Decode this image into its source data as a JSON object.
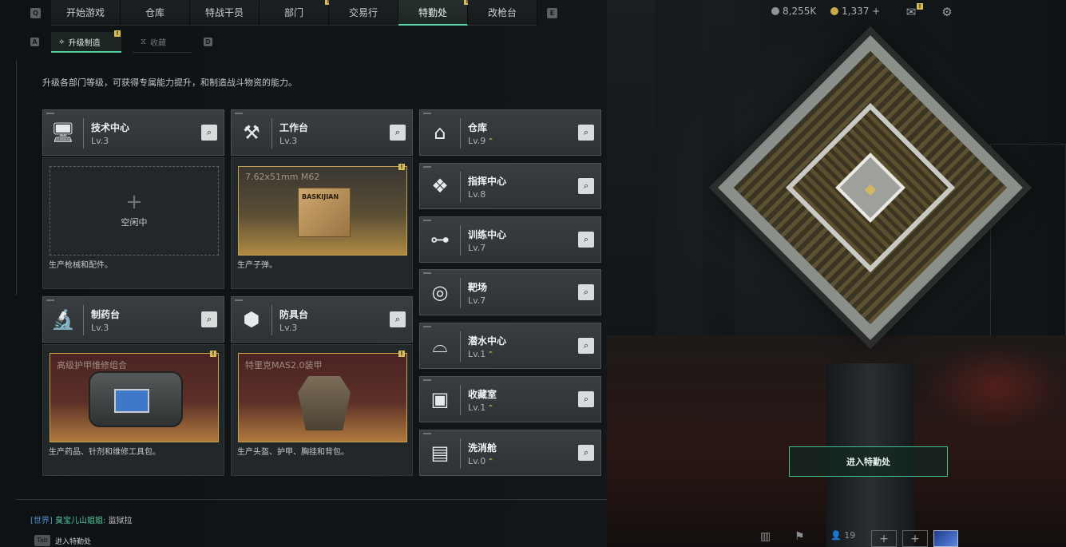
{
  "nav": {
    "left_key": "Q",
    "right_key": "E",
    "tabs": [
      {
        "label": "开始游戏",
        "badge": ""
      },
      {
        "label": "仓库",
        "badge": ""
      },
      {
        "label": "特战干员",
        "badge": ""
      },
      {
        "label": "部门",
        "badge": "!"
      },
      {
        "label": "交易行",
        "badge": ""
      },
      {
        "label": "特勤处",
        "badge": "!",
        "active": true
      },
      {
        "label": "改枪台",
        "badge": ""
      }
    ],
    "currency_silver": "8,255K",
    "currency_gold": "1,337 +",
    "mail_badge": "!",
    "icons": [
      "silver-coin-icon",
      "gold-coin-icon",
      "mail-icon",
      "gear-icon"
    ]
  },
  "subnav": {
    "left_key": "A",
    "right_key": "D",
    "active_label": "升级制造",
    "active_badge": "!",
    "inactive_label": "收藏"
  },
  "description": "升级各部门等级，可获得专属能力提升，和制造战斗物资的能力。",
  "workshops": [
    {
      "name": "技术中心",
      "level": "Lv.3",
      "icon": "monitor-icon",
      "slot": {
        "type": "idle",
        "idle_label": "空闲中",
        "plus": "+"
      },
      "caption": "生产枪械和配件。"
    },
    {
      "name": "工作台",
      "level": "Lv.3",
      "icon": "tools-icon",
      "slot": {
        "type": "item",
        "item_name": "7.62x51mm M62",
        "badge": "!",
        "box_label": "BASKIJIAN"
      },
      "caption": "生产子弹。"
    },
    {
      "name": "制药台",
      "level": "Lv.3",
      "icon": "microscope-icon",
      "slot": {
        "type": "item",
        "item_name": "高级护甲维修组合",
        "badge": "!"
      },
      "caption": "生产药品、针剂和维修工具包。"
    },
    {
      "name": "防具台",
      "level": "Lv.3",
      "icon": "cubes-icon",
      "slot": {
        "type": "item",
        "item_name": "特里克MAS2.0装甲",
        "badge": "!"
      },
      "caption": "生产头盔、护甲、胸挂和背包。"
    }
  ],
  "facilities": [
    {
      "name": "仓库",
      "level": "Lv.9",
      "upgrade": "⌃",
      "icon": "warehouse-icon"
    },
    {
      "name": "指挥中心",
      "level": "Lv.8",
      "upgrade": "",
      "icon": "command-icon"
    },
    {
      "name": "训练中心",
      "level": "Lv.7",
      "upgrade": "",
      "icon": "dumbbell-icon"
    },
    {
      "name": "靶场",
      "level": "Lv.7",
      "upgrade": "",
      "icon": "target-icon"
    },
    {
      "name": "潜水中心",
      "level": "Lv.1",
      "upgrade": "⌃",
      "icon": "goggles-icon"
    },
    {
      "name": "收藏室",
      "level": "Lv.1",
      "upgrade": "⌃",
      "icon": "vault-icon"
    },
    {
      "name": "洗消舱",
      "level": "Lv.0",
      "upgrade": "⌃",
      "icon": "decon-icon"
    }
  ],
  "enter_button": "进入特勤处",
  "chat": {
    "channel": "[世界]",
    "user": "臭宝儿山姐姐:",
    "message": "监狱拉"
  },
  "tab_hint": {
    "key": "Tab",
    "label": "进入特勤处"
  },
  "bottom": {
    "friends_count": "19"
  }
}
